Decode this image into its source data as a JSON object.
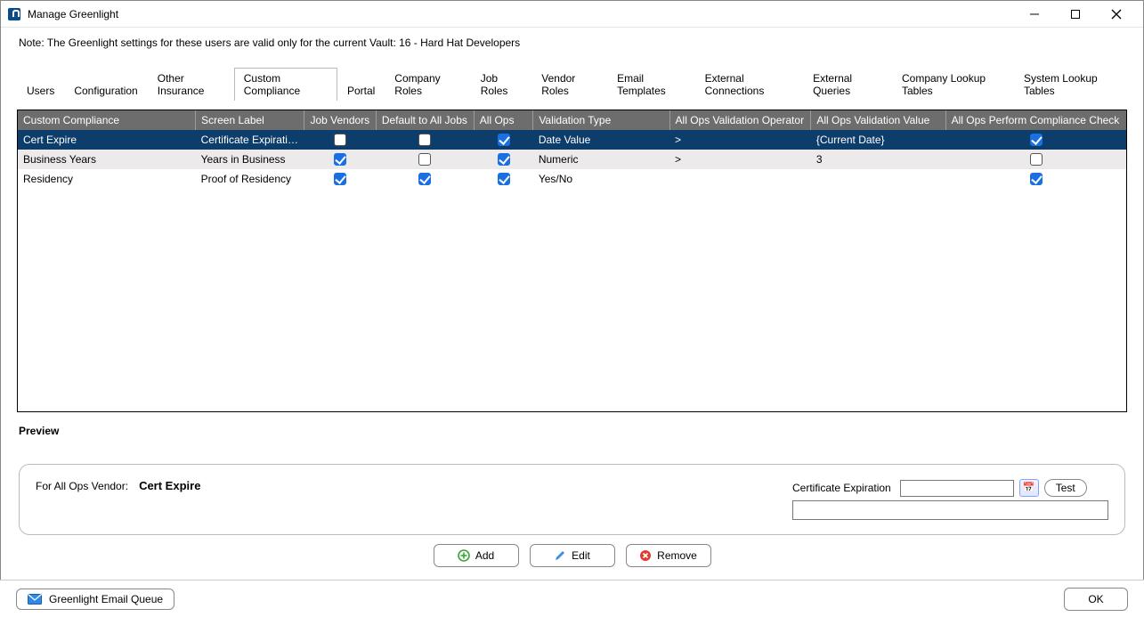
{
  "window": {
    "title": "Manage Greenlight"
  },
  "note": "Note:  The Greenlight settings for these users are valid only for the current Vault: 16 - Hard Hat Developers",
  "tabs": [
    "Users",
    "Configuration",
    "Other Insurance",
    "Custom Compliance",
    "Portal",
    "Company Roles",
    "Job Roles",
    "Vendor Roles",
    "Email Templates",
    "External Connections",
    "External Queries",
    "Company Lookup Tables",
    "System Lookup Tables"
  ],
  "active_tab_index": 3,
  "columns": [
    "Custom Compliance",
    "Screen Label",
    "Job Vendors",
    "Default to All Jobs",
    "All Ops",
    "Validation Type",
    "All Ops Validation Operator",
    "All Ops Validation Value",
    "All Ops Perform Compliance Check"
  ],
  "rows": [
    {
      "cc": "Cert Expire",
      "sl": "Certificate Expirati…",
      "jv": false,
      "da": false,
      "ao": true,
      "vt": "Date Value",
      "op": ">",
      "vv": "{Current Date}",
      "pc": true,
      "style": "sel"
    },
    {
      "cc": "Business Years",
      "sl": "Years in Business",
      "jv": true,
      "da": false,
      "ao": true,
      "vt": "Numeric",
      "op": ">",
      "vv": "3",
      "pc": false,
      "style": "alt"
    },
    {
      "cc": "Residency",
      "sl": "Proof of Residency",
      "jv": true,
      "da": true,
      "ao": true,
      "vt": "Yes/No",
      "op": "",
      "vv": "",
      "pc": true,
      "style": ""
    }
  ],
  "preview": {
    "heading": "Preview",
    "left_label": "For All Ops Vendor:",
    "left_value": "Cert Expire",
    "right_label": "Certificate Expiration",
    "test_label": "Test"
  },
  "actions": {
    "add": "Add",
    "edit": "Edit",
    "remove": "Remove"
  },
  "footer": {
    "email": "Greenlight Email Queue",
    "ok": "OK"
  }
}
